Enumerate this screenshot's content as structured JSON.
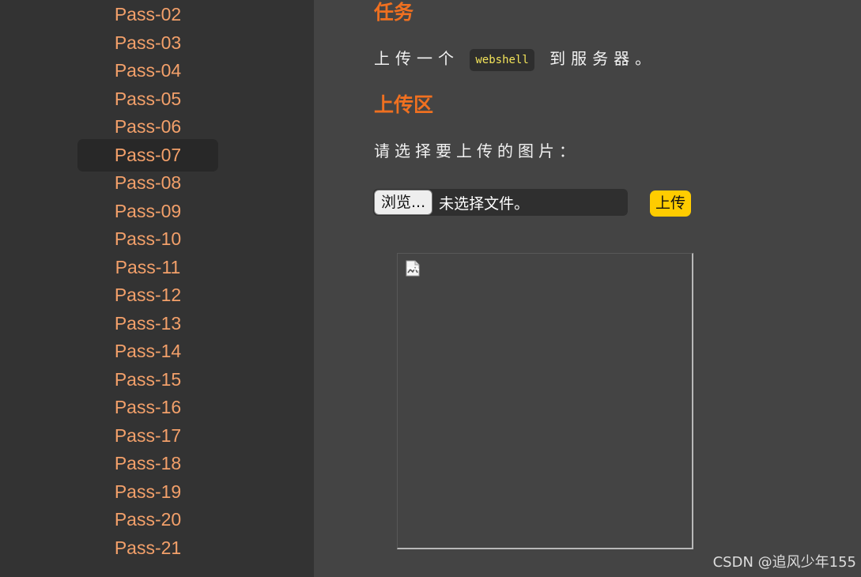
{
  "sidebar": {
    "items": [
      {
        "label": "Pass-02",
        "active": false
      },
      {
        "label": "Pass-03",
        "active": false
      },
      {
        "label": "Pass-04",
        "active": false
      },
      {
        "label": "Pass-05",
        "active": false
      },
      {
        "label": "Pass-06",
        "active": false
      },
      {
        "label": "Pass-07",
        "active": true
      },
      {
        "label": "Pass-08",
        "active": false
      },
      {
        "label": "Pass-09",
        "active": false
      },
      {
        "label": "Pass-10",
        "active": false
      },
      {
        "label": "Pass-11",
        "active": false
      },
      {
        "label": "Pass-12",
        "active": false
      },
      {
        "label": "Pass-13",
        "active": false
      },
      {
        "label": "Pass-14",
        "active": false
      },
      {
        "label": "Pass-15",
        "active": false
      },
      {
        "label": "Pass-16",
        "active": false
      },
      {
        "label": "Pass-17",
        "active": false
      },
      {
        "label": "Pass-18",
        "active": false
      },
      {
        "label": "Pass-19",
        "active": false
      },
      {
        "label": "Pass-20",
        "active": false
      },
      {
        "label": "Pass-21",
        "active": false
      }
    ]
  },
  "task": {
    "heading": "任务",
    "text_before": "上传一个",
    "code": "webshell",
    "text_after": "到服务器。"
  },
  "upload": {
    "heading": "上传区",
    "prompt": "请选择要上传的图片：",
    "browse_label": "浏览...",
    "file_status": "未选择文件。",
    "submit_label": "上传",
    "preview_icon": "broken-image-icon"
  },
  "watermark": "CSDN @追风少年155",
  "colors": {
    "page_background": "#444444",
    "sidebar_background": "#333333",
    "active_item_background": "#282828",
    "link_color": "#f3a06a",
    "heading_color": "#f07020",
    "code_color": "#f2e35a",
    "button_accent": "#ffcc00"
  }
}
